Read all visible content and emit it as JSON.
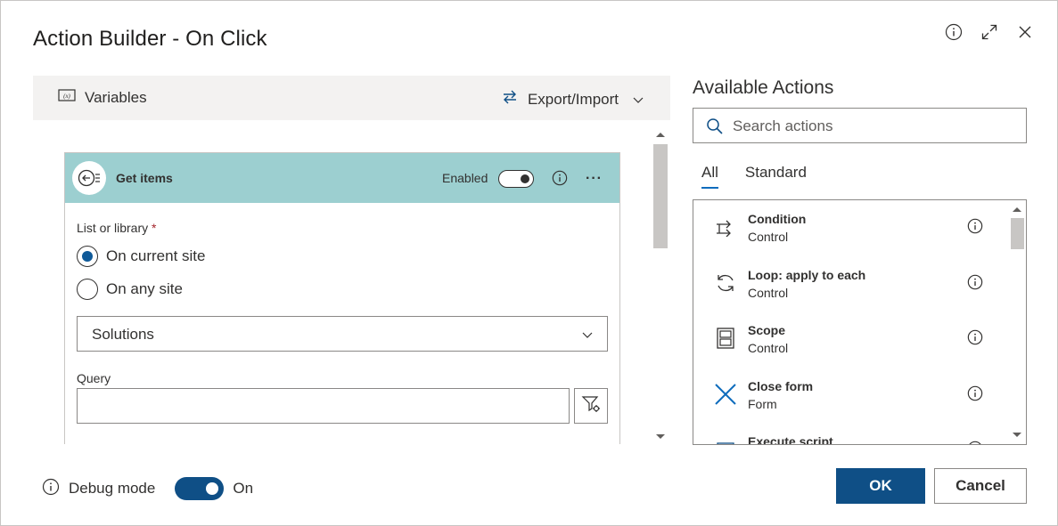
{
  "dialog": {
    "title": "Action Builder - On Click"
  },
  "header_icons": [
    "info-icon",
    "expand-icon",
    "close-icon"
  ],
  "toolbar": {
    "variables_label": "Variables",
    "export_import_label": "Export/Import"
  },
  "card": {
    "title": "Get items",
    "enabled_label": "Enabled",
    "enabled": true,
    "more_label": "···",
    "list_label": "List or library",
    "required_mark": "*",
    "radio_options": [
      {
        "label": "On current site",
        "selected": true
      },
      {
        "label": "On any site",
        "selected": false
      }
    ],
    "list_value": "Solutions",
    "query_label": "Query",
    "query_value": ""
  },
  "available": {
    "title": "Available Actions",
    "search_placeholder": "Search actions",
    "tabs": [
      {
        "label": "All",
        "active": true
      },
      {
        "label": "Standard",
        "active": false
      }
    ],
    "actions": [
      {
        "name": "Condition",
        "category": "Control",
        "icon": "condition-icon"
      },
      {
        "name": "Loop: apply to each",
        "category": "Control",
        "icon": "loop-icon"
      },
      {
        "name": "Scope",
        "category": "Control",
        "icon": "scope-icon"
      },
      {
        "name": "Close form",
        "category": "Form",
        "icon": "close-form-icon"
      },
      {
        "name": "Execute script",
        "category": "",
        "icon": "execute-script-icon"
      }
    ]
  },
  "footer": {
    "debug_label": "Debug mode",
    "debug_state": "On",
    "ok_label": "OK",
    "cancel_label": "Cancel"
  },
  "colors": {
    "primary": "#0f4f86",
    "card_header": "#9ccfd0",
    "radio_selected": "#0f5a99",
    "close_form_icon": "#0f6cbd"
  }
}
